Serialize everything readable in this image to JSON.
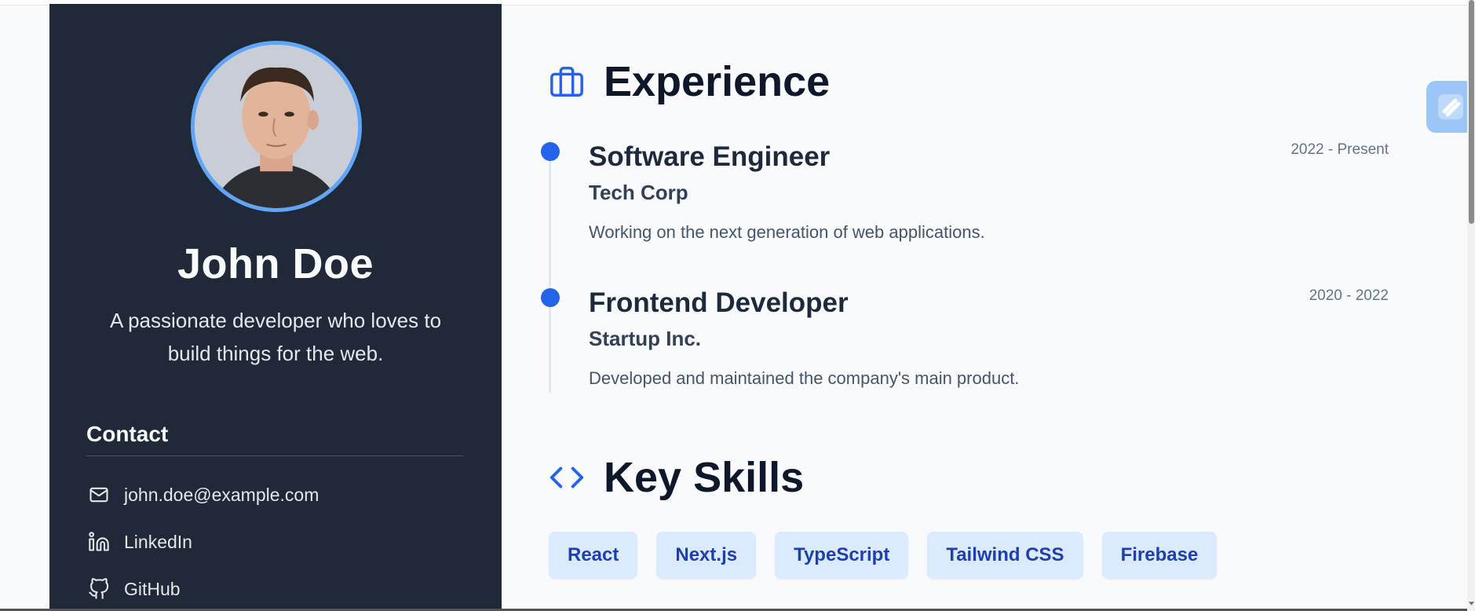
{
  "profile": {
    "name": "John Doe",
    "bio": "A passionate developer who loves to build things for the web.",
    "avatar_alt": "Profile photo"
  },
  "contact": {
    "title": "Contact",
    "items": [
      {
        "label": "john.doe@example.com",
        "icon": "mail-icon"
      },
      {
        "label": "LinkedIn",
        "icon": "linkedin-icon"
      },
      {
        "label": "GitHub",
        "icon": "github-icon"
      }
    ]
  },
  "experience": {
    "title": "Experience",
    "icon": "briefcase-icon",
    "jobs": [
      {
        "title": "Software Engineer",
        "company": "Tech Corp",
        "description": "Working on the next generation of web applications.",
        "date": "2022 - Present"
      },
      {
        "title": "Frontend Developer",
        "company": "Startup Inc.",
        "description": "Developed and maintained the company's main product.",
        "date": "2020 - 2022"
      }
    ]
  },
  "skills": {
    "title": "Key Skills",
    "icon": "code-icon",
    "items": [
      "React",
      "Next.js",
      "TypeScript",
      "Tailwind CSS",
      "Firebase"
    ]
  },
  "colors": {
    "sidebar_bg": "#1f2937",
    "accent": "#2563eb",
    "avatar_ring": "#60a5fa",
    "skill_bg": "#dbeafe",
    "skill_text": "#1e40af"
  }
}
